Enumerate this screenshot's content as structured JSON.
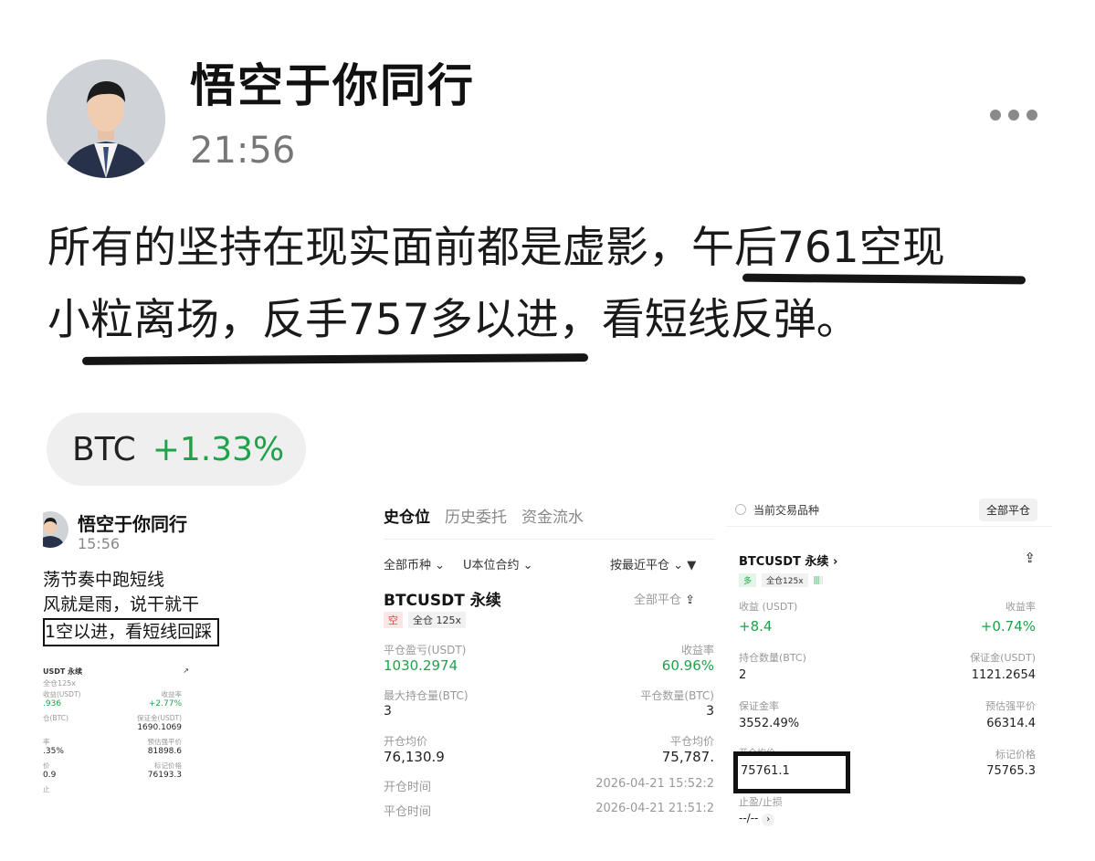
{
  "post": {
    "author": "悟空于你同行",
    "time": "21:56",
    "text_line1": "所有的坚持在现实面前都是虚影，午后761空现",
    "text_line2": "小粒离场，反手757多以进，看短线反弹。"
  },
  "ticker": {
    "symbol": "BTC",
    "change": "+1.33%",
    "color": "#1fa34a"
  },
  "panel_old_post": {
    "author": "悟空于你同行",
    "time": "15:56",
    "line1": "荡节奏中跑短线",
    "line2": "风就是雨，说干就干",
    "line3": "1空以进，看短线回踩",
    "mini": {
      "pair": "USDT 永续",
      "tag": "全仓125x",
      "col_l1": "收益(USDT)",
      "val_l1": ".936",
      "col_r1": "收益率",
      "val_r1": "+2.77%",
      "col_l2": "仓(BTC)",
      "col_r2": "保证金(USDT)",
      "val_r2": "1690.1069",
      "col_l3": "率",
      "col_r3": "预估强平价",
      "val_l3": ".35%",
      "val_r3": "81898.6",
      "col_l4": "价",
      "col_r4": "标记价格",
      "val_l4": "0.9",
      "val_r4": "76193.3",
      "foot": "止"
    }
  },
  "panel_history": {
    "tabs": [
      "史仓位",
      "历史委托",
      "资金流水"
    ],
    "filters": [
      "全部币种",
      "U本位合约",
      "按最近平仓"
    ],
    "pair": "BTCUSDT 永续",
    "close_all": "全部平仓",
    "side": "空",
    "margin": "全仓 125x",
    "pnl_label": "平仓盈亏(USDT)",
    "pnl_value": "1030.2974",
    "roe_label": "收益率",
    "roe_value": "60.96%",
    "maxpos_label": "最大持仓量(BTC)",
    "maxpos_value": "3",
    "closeqty_label": "平仓数量(BTC)",
    "closeqty_value": "3",
    "open_avg_label": "开仓均价",
    "open_avg_value": "76,130.9",
    "close_avg_label": "平仓均价",
    "close_avg_value": "75,787.",
    "open_time_label": "开仓时间",
    "open_time_value": "2026-04-21 15:52:2",
    "close_time_label": "平仓时间",
    "close_time_value": "2026-04-21 21:51:2"
  },
  "panel_position": {
    "current_label": "当前交易品种",
    "close_all": "全部平仓",
    "pair": "BTCUSDT 永续",
    "side": "多",
    "margin": "全仓125x",
    "pnl_label": "收益 (USDT)",
    "pnl_value": "+8.4",
    "roe_label": "收益率",
    "roe_value": "+0.74%",
    "size_label": "持仓数量(BTC)",
    "size_value": "2",
    "margin_label": "保证金(USDT)",
    "margin_value": "1121.2654",
    "ratio_label": "保证金率",
    "ratio_value": "3552.49%",
    "liq_label": "预估强平价",
    "liq_value": "66314.4",
    "entry_label": "开仓均价",
    "entry_value": "75761.1",
    "mark_label": "标记价格",
    "mark_value": "75765.3",
    "tpsl_label": "止盈/止损",
    "tpsl_value": "--/--"
  }
}
